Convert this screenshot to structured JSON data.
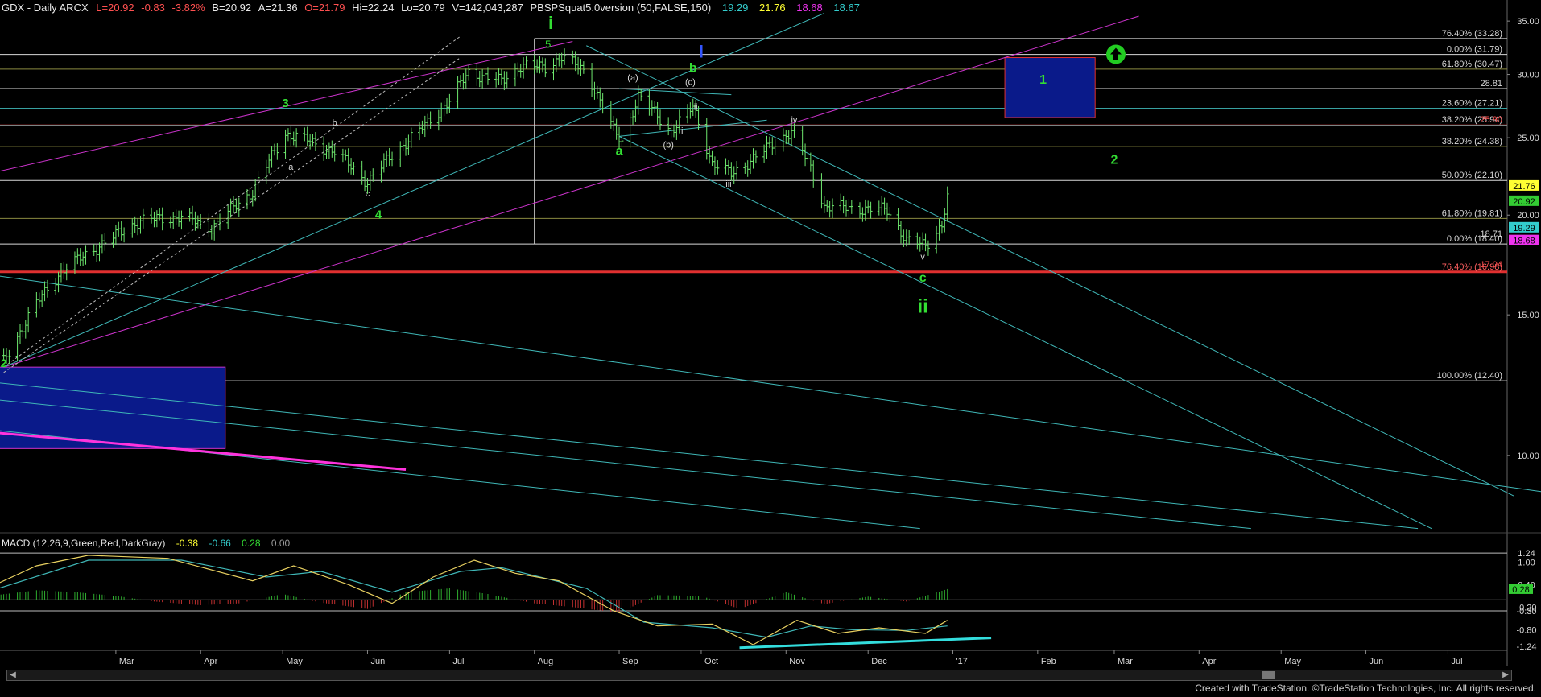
{
  "header": {
    "symbol": "GDX - Daily  ARCX",
    "last": "L=20.92",
    "change": "-0.83",
    "change_pct": "-3.82%",
    "bid": "B=20.92",
    "ask": "A=21.36",
    "open": "O=21.79",
    "high": "Hi=22.24",
    "low": "Lo=20.79",
    "volume": "V=142,043,287",
    "indicator": "PBSPSquat5.0version (50,FALSE,150)",
    "ind_v1": "19.29",
    "ind_v2": "21.76",
    "ind_v3": "18.68",
    "ind_v4": "18.67"
  },
  "macd_header": {
    "label": "MACD (12,26,9,Green,Red,DarkGray)",
    "v1": "-0.38",
    "v2": "-0.66",
    "v3": "0.28",
    "v4": "0.00"
  },
  "credit": "Created with TradeStation. ©TradeStation Technologies, Inc. All rights reserved.",
  "colors": {
    "bg": "#000000",
    "bar": "#6ee86e",
    "cyan": "#3fb7b7",
    "magenta": "#cc33cc",
    "red": "#e03030",
    "white": "#d8d8d8",
    "olive": "#8a8a40",
    "green": "#33dd33",
    "navy": "#0a1a8a",
    "hist_pos": "#2fae2f",
    "hist_neg": "#c23030"
  },
  "chart_data": {
    "type": "bar",
    "title": "GDX - Daily ARCX",
    "xlabel": "",
    "ylabel": "",
    "ylim": [
      8,
      36
    ],
    "y_scale": "log",
    "y_ticks": [
      "35.00",
      "30.00",
      "25.00",
      "20.00",
      "15.00",
      "10.00"
    ],
    "x_ticks": [
      "Mar",
      "Apr",
      "May",
      "Jun",
      "Jul",
      "Aug",
      "Sep",
      "Oct",
      "Nov",
      "Dec",
      "'17",
      "Feb",
      "Mar",
      "Apr",
      "May",
      "Jun",
      "Jul"
    ],
    "price_path": [
      [
        "2016-01-20",
        13.1
      ],
      [
        "2016-02-01",
        15.5
      ],
      [
        "2016-02-10",
        17.0
      ],
      [
        "2016-02-25",
        18.4
      ],
      [
        "2016-03-10",
        19.7
      ],
      [
        "2016-03-25",
        19.9
      ],
      [
        "2016-04-05",
        19.3
      ],
      [
        "2016-04-20",
        21.4
      ],
      [
        "2016-05-02",
        25.3
      ],
      [
        "2016-05-10",
        24.8
      ],
      [
        "2016-05-20",
        24.0
      ],
      [
        "2016-06-01",
        22.0
      ],
      [
        "2016-06-10",
        23.8
      ],
      [
        "2016-06-20",
        25.5
      ],
      [
        "2016-07-01",
        27.8
      ],
      [
        "2016-07-08",
        30.2
      ],
      [
        "2016-07-20",
        29.4
      ],
      [
        "2016-07-27",
        30.8
      ],
      [
        "2016-08-05",
        30.6
      ],
      [
        "2016-08-11",
        31.6
      ],
      [
        "2016-08-20",
        30.2
      ],
      [
        "2016-08-30",
        25.5
      ],
      [
        "2016-09-02",
        24.7
      ],
      [
        "2016-09-08",
        28.2
      ],
      [
        "2016-09-20",
        25.5
      ],
      [
        "2016-09-28",
        27.3
      ],
      [
        "2016-10-05",
        23.2
      ],
      [
        "2016-10-12",
        22.5
      ],
      [
        "2016-10-22",
        23.8
      ],
      [
        "2016-11-03",
        25.5
      ],
      [
        "2016-11-10",
        22.9
      ],
      [
        "2016-11-15",
        20.5
      ],
      [
        "2016-11-25",
        20.4
      ],
      [
        "2016-12-08",
        20.3
      ],
      [
        "2016-12-15",
        18.6
      ],
      [
        "2016-12-22",
        18.3
      ],
      [
        "2016-12-28",
        19.5
      ],
      [
        "2016-12-30",
        21.0
      ]
    ],
    "fib_levels": [
      {
        "label": "76.40% (33.28)",
        "value": 33.28
      },
      {
        "label": "0.00% (31.79)",
        "value": 31.79
      },
      {
        "label": "61.80% (30.47)",
        "value": 30.47
      },
      {
        "label": "28.81",
        "value": 28.81
      },
      {
        "label": "23.60% (27.21)",
        "value": 27.21
      },
      {
        "label": "38.20% (25.94)",
        "value": 25.94
      },
      {
        "label": "38.20% (24.38)",
        "value": 24.38
      },
      {
        "label": "50.00% (22.10)",
        "value": 22.1
      },
      {
        "label": "61.80% (19.81)",
        "value": 19.81
      },
      {
        "label": "0.00% (18.40)",
        "value": 18.4
      },
      {
        "label": "76.40% (16.98)",
        "value": 16.98
      },
      {
        "label": "100.00% (12.40)",
        "value": 12.4
      }
    ],
    "overlay_values": [
      "25.90",
      "18.71",
      "17.04"
    ],
    "price_badges": [
      {
        "value": "21.76",
        "bg": "#ffff33",
        "fg": "#000000"
      },
      {
        "value": "20.92",
        "bg": "#33cc33",
        "fg": "#000000"
      },
      {
        "value": "19.29",
        "bg": "#33cccc",
        "fg": "#000000"
      },
      {
        "value": "18.68",
        "bg": "#ee33ee",
        "fg": "#000000"
      }
    ],
    "wave_labels": [
      {
        "text": "2",
        "date": "2016-01-20",
        "price": 12.9,
        "color": "#33dd33",
        "size": 14
      },
      {
        "text": "3",
        "date": "2016-05-02",
        "price": 27.3,
        "color": "#33dd33",
        "size": 15
      },
      {
        "text": "4",
        "date": "2016-06-05",
        "price": 19.8,
        "color": "#33dd33",
        "size": 15
      },
      {
        "text": "a",
        "date": "2016-05-04",
        "price": 22.8,
        "color": "#d8d8d8",
        "size": 11
      },
      {
        "text": "b",
        "date": "2016-05-20",
        "price": 25.9,
        "color": "#d8d8d8",
        "size": 11
      },
      {
        "text": "c",
        "date": "2016-06-01",
        "price": 21.1,
        "color": "#d8d8d8",
        "size": 11
      },
      {
        "text": "i",
        "date": "2016-08-07",
        "price": 34.2,
        "color": "#33dd33",
        "size": 22
      },
      {
        "text": "5",
        "date": "2016-08-06",
        "price": 32.4,
        "color": "#33dd33",
        "size": 13
      },
      {
        "text": "I",
        "date": "2016-10-01",
        "price": 31.5,
        "color": "#3355ff",
        "size": 22
      },
      {
        "text": "b",
        "date": "2016-09-28",
        "price": 30.2,
        "color": "#33dd33",
        "size": 16
      },
      {
        "text": "(a)",
        "date": "2016-09-06",
        "price": 29.5,
        "color": "#d8d8d8",
        "size": 11
      },
      {
        "text": "(c)",
        "date": "2016-09-27",
        "price": 29.1,
        "color": "#d8d8d8",
        "size": 11
      },
      {
        "text": "ii",
        "date": "2016-09-29",
        "price": 27.1,
        "color": "#d8d8d8",
        "size": 11
      },
      {
        "text": "i",
        "date": "2016-09-24",
        "price": 25.3,
        "color": "#d8d8d8",
        "size": 11
      },
      {
        "text": "(b)",
        "date": "2016-09-19",
        "price": 24.3,
        "color": "#d8d8d8",
        "size": 11
      },
      {
        "text": "a",
        "date": "2016-09-01",
        "price": 23.8,
        "color": "#33dd33",
        "size": 16
      },
      {
        "text": "iii",
        "date": "2016-10-11",
        "price": 21.7,
        "color": "#d8d8d8",
        "size": 11
      },
      {
        "text": "iv",
        "date": "2016-11-04",
        "price": 26.1,
        "color": "#d8d8d8",
        "size": 11
      },
      {
        "text": "v",
        "date": "2016-12-21",
        "price": 17.6,
        "color": "#d8d8d8",
        "size": 11
      },
      {
        "text": "c",
        "date": "2016-12-21",
        "price": 16.5,
        "color": "#33dd33",
        "size": 16
      },
      {
        "text": "ii",
        "date": "2016-12-21",
        "price": 15.1,
        "color": "#33dd33",
        "size": 24
      },
      {
        "text": "1",
        "date": "2017-02-03",
        "price": 29.2,
        "color": "#33dd33",
        "size": 16
      },
      {
        "text": "2",
        "date": "2017-03-01",
        "price": 23.2,
        "color": "#33dd33",
        "size": 16
      }
    ],
    "boxes": [
      {
        "label": "target-box-1",
        "d1": "2017-01-20",
        "d2": "2017-02-22",
        "p_hi": 31.5,
        "p_lo": 26.5
      },
      {
        "label": "support-box",
        "d1": "2016-01-05",
        "d2": "2016-04-10",
        "p_hi": 12.9,
        "p_lo": 10.2
      }
    ],
    "channels": [
      {
        "kind": "magenta",
        "p1": [
          "2016-01-01",
          22.0
        ],
        "p2": [
          "2016-08-15",
          33.0
        ]
      },
      {
        "kind": "magenta",
        "p1": [
          "2016-01-20",
          12.9
        ],
        "p2": [
          "2017-03-10",
          35.5
        ]
      },
      {
        "kind": "cyan",
        "p1": [
          "2016-01-20",
          12.9
        ],
        "p2": [
          "2016-11-15",
          35.8
        ]
      },
      {
        "kind": "cyan",
        "p1": [
          "2016-08-20",
          32.6
        ],
        "p2": [
          "2017-07-25",
          8.9
        ]
      },
      {
        "kind": "cyan",
        "p1": [
          "2016-09-01",
          25.1
        ],
        "p2": [
          "2017-06-25",
          8.1
        ]
      },
      {
        "kind": "cyan",
        "p1": [
          "2016-01-01",
          17.1
        ],
        "p2": [
          "2017-08-05",
          9.0
        ]
      },
      {
        "kind": "cyan",
        "p1": [
          "2016-01-01",
          12.5
        ],
        "p2": [
          "2017-06-20",
          8.1
        ]
      },
      {
        "kind": "cyan",
        "p1": [
          "2016-01-01",
          11.9
        ],
        "p2": [
          "2017-04-20",
          8.1
        ]
      },
      {
        "kind": "cyan",
        "p1": [
          "2016-01-01",
          10.9
        ],
        "p2": [
          "2016-12-20",
          8.1
        ]
      },
      {
        "kind": "cyan",
        "p1": [
          "2016-09-01",
          28.8
        ],
        "p2": [
          "2016-10-12",
          28.3
        ]
      },
      {
        "kind": "cyan",
        "p1": [
          "2016-09-01",
          25.1
        ],
        "p2": [
          "2016-10-25",
          26.3
        ]
      },
      {
        "kind": "dashed",
        "p1": [
          "2016-01-20",
          12.9
        ],
        "p2": [
          "2016-07-05",
          33.5
        ]
      },
      {
        "kind": "dashed",
        "p1": [
          "2016-01-20",
          12.7
        ],
        "p2": [
          "2016-07-05",
          31.5
        ]
      },
      {
        "kind": "pinkthick",
        "p1": [
          "2016-01-01",
          10.8
        ],
        "p2": [
          "2016-06-15",
          9.6
        ]
      }
    ],
    "hlines": [
      {
        "value": 33.28,
        "color": "#d8d8d8",
        "from": "2016-08-01"
      },
      {
        "value": 31.79,
        "color": "#d8d8d8",
        "from": "2016-01-01"
      },
      {
        "value": 30.47,
        "color": "#8a8a40",
        "from": "2016-01-01"
      },
      {
        "value": 28.81,
        "color": "#d8d8d8",
        "from": "2016-01-01"
      },
      {
        "value": 27.21,
        "color": "#3fb7b7",
        "from": "2016-01-01"
      },
      {
        "value": 25.94,
        "color": "#e03030",
        "from": "2016-01-01"
      },
      {
        "value": 25.9,
        "color": "#3fb7b7",
        "from": "2016-01-01"
      },
      {
        "value": 24.38,
        "color": "#8a8a40",
        "from": "2016-01-01"
      },
      {
        "value": 22.1,
        "color": "#d8d8d8",
        "from": "2016-01-01"
      },
      {
        "value": 19.81,
        "color": "#8a8a40",
        "from": "2016-01-01"
      },
      {
        "value": 18.4,
        "color": "#d8d8d8",
        "from": "2016-01-01"
      },
      {
        "value": 16.98,
        "color": "#e03030",
        "from": "2016-01-01",
        "width": 3
      },
      {
        "value": 12.4,
        "color": "#d8d8d8",
        "from": "2016-01-01"
      }
    ],
    "macd": {
      "ylim": [
        -1.35,
        1.35
      ],
      "y_ticks": [
        "1.24",
        "1.00",
        "0.40",
        "-0.30",
        "-0.20",
        "-0.80",
        "-1.24"
      ],
      "hlines": [
        1.24,
        -0.3
      ],
      "macd_path": [
        [
          "2016-01-05",
          0.0
        ],
        [
          "2016-02-01",
          0.9
        ],
        [
          "2016-02-20",
          1.18
        ],
        [
          "2016-03-20",
          1.1
        ],
        [
          "2016-04-20",
          0.5
        ],
        [
          "2016-05-05",
          0.9
        ],
        [
          "2016-05-25",
          0.4
        ],
        [
          "2016-06-10",
          -0.1
        ],
        [
          "2016-06-25",
          0.6
        ],
        [
          "2016-07-10",
          1.05
        ],
        [
          "2016-07-25",
          0.7
        ],
        [
          "2016-08-10",
          0.5
        ],
        [
          "2016-08-30",
          -0.3
        ],
        [
          "2016-09-15",
          -0.7
        ],
        [
          "2016-10-05",
          -0.65
        ],
        [
          "2016-10-20",
          -1.2
        ],
        [
          "2016-11-05",
          -0.55
        ],
        [
          "2016-11-20",
          -0.9
        ],
        [
          "2016-12-05",
          -0.75
        ],
        [
          "2016-12-22",
          -0.9
        ],
        [
          "2016-12-30",
          -0.55
        ]
      ],
      "signal_path": [
        [
          "2016-01-05",
          0.0
        ],
        [
          "2016-02-20",
          1.05
        ],
        [
          "2016-03-25",
          1.05
        ],
        [
          "2016-04-25",
          0.6
        ],
        [
          "2016-05-15",
          0.75
        ],
        [
          "2016-06-10",
          0.2
        ],
        [
          "2016-07-05",
          0.75
        ],
        [
          "2016-07-20",
          0.85
        ],
        [
          "2016-08-20",
          0.3
        ],
        [
          "2016-09-10",
          -0.6
        ],
        [
          "2016-10-05",
          -0.75
        ],
        [
          "2016-10-25",
          -1.0
        ],
        [
          "2016-11-10",
          -0.7
        ],
        [
          "2016-11-25",
          -0.8
        ],
        [
          "2016-12-15",
          -0.82
        ],
        [
          "2016-12-30",
          -0.7
        ]
      ],
      "histogram": [
        [
          "2016-01-15",
          0.1
        ],
        [
          "2016-02-01",
          0.25
        ],
        [
          "2016-02-15",
          0.2
        ],
        [
          "2016-03-01",
          0.1
        ],
        [
          "2016-03-15",
          -0.05
        ],
        [
          "2016-04-01",
          -0.15
        ],
        [
          "2016-04-15",
          -0.1
        ],
        [
          "2016-05-01",
          0.15
        ],
        [
          "2016-05-15",
          -0.08
        ],
        [
          "2016-06-01",
          -0.25
        ],
        [
          "2016-06-15",
          0.2
        ],
        [
          "2016-07-01",
          0.3
        ],
        [
          "2016-07-15",
          0.15
        ],
        [
          "2016-08-01",
          -0.1
        ],
        [
          "2016-08-15",
          -0.2
        ],
        [
          "2016-09-01",
          -0.35
        ],
        [
          "2016-09-15",
          0.12
        ],
        [
          "2016-10-01",
          0.1
        ],
        [
          "2016-10-15",
          -0.25
        ],
        [
          "2016-11-01",
          0.2
        ],
        [
          "2016-11-15",
          -0.12
        ],
        [
          "2016-12-01",
          0.08
        ],
        [
          "2016-12-15",
          -0.05
        ],
        [
          "2016-12-30",
          0.28
        ]
      ],
      "divergence": {
        "p1": [
          "2016-10-15",
          -1.28
        ],
        "p2": [
          "2017-01-15",
          -1.02
        ]
      }
    }
  }
}
